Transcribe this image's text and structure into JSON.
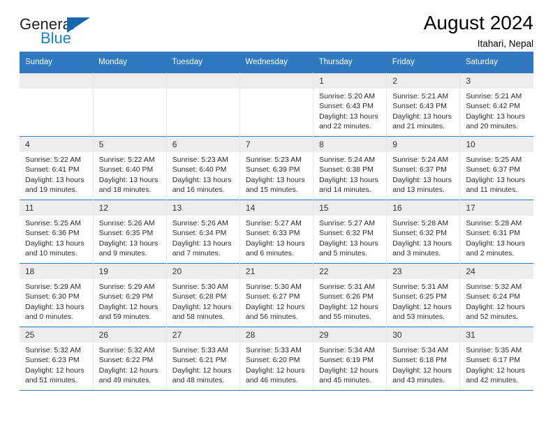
{
  "brand": {
    "name_part1": "General",
    "name_part2": "Blue",
    "accent_color": "#1767ad",
    "text_color": "#231f20"
  },
  "header": {
    "title": "August 2024",
    "location": "Itahari, Nepal"
  },
  "calendar": {
    "header_bg": "#2e79c0",
    "daynum_bg": "#ededed",
    "weekday_headers": [
      "Sunday",
      "Monday",
      "Tuesday",
      "Wednesday",
      "Thursday",
      "Friday",
      "Saturday"
    ],
    "labels": {
      "sunrise_prefix": "Sunrise:",
      "sunset_prefix": "Sunset:",
      "daylight_prefix": "Daylight:"
    },
    "weeks": [
      [
        {
          "day": "",
          "sunrise": "",
          "sunset": "",
          "daylight_line1": "",
          "daylight_line2": ""
        },
        {
          "day": "",
          "sunrise": "",
          "sunset": "",
          "daylight_line1": "",
          "daylight_line2": ""
        },
        {
          "day": "",
          "sunrise": "",
          "sunset": "",
          "daylight_line1": "",
          "daylight_line2": ""
        },
        {
          "day": "",
          "sunrise": "",
          "sunset": "",
          "daylight_line1": "",
          "daylight_line2": ""
        },
        {
          "day": "1",
          "sunrise": "Sunrise: 5:20 AM",
          "sunset": "Sunset: 6:43 PM",
          "daylight_line1": "Daylight: 13 hours",
          "daylight_line2": "and 22 minutes."
        },
        {
          "day": "2",
          "sunrise": "Sunrise: 5:21 AM",
          "sunset": "Sunset: 6:43 PM",
          "daylight_line1": "Daylight: 13 hours",
          "daylight_line2": "and 21 minutes."
        },
        {
          "day": "3",
          "sunrise": "Sunrise: 5:21 AM",
          "sunset": "Sunset: 6:42 PM",
          "daylight_line1": "Daylight: 13 hours",
          "daylight_line2": "and 20 minutes."
        }
      ],
      [
        {
          "day": "4",
          "sunrise": "Sunrise: 5:22 AM",
          "sunset": "Sunset: 6:41 PM",
          "daylight_line1": "Daylight: 13 hours",
          "daylight_line2": "and 19 minutes."
        },
        {
          "day": "5",
          "sunrise": "Sunrise: 5:22 AM",
          "sunset": "Sunset: 6:40 PM",
          "daylight_line1": "Daylight: 13 hours",
          "daylight_line2": "and 18 minutes."
        },
        {
          "day": "6",
          "sunrise": "Sunrise: 5:23 AM",
          "sunset": "Sunset: 6:40 PM",
          "daylight_line1": "Daylight: 13 hours",
          "daylight_line2": "and 16 minutes."
        },
        {
          "day": "7",
          "sunrise": "Sunrise: 5:23 AM",
          "sunset": "Sunset: 6:39 PM",
          "daylight_line1": "Daylight: 13 hours",
          "daylight_line2": "and 15 minutes."
        },
        {
          "day": "8",
          "sunrise": "Sunrise: 5:24 AM",
          "sunset": "Sunset: 6:38 PM",
          "daylight_line1": "Daylight: 13 hours",
          "daylight_line2": "and 14 minutes."
        },
        {
          "day": "9",
          "sunrise": "Sunrise: 5:24 AM",
          "sunset": "Sunset: 6:37 PM",
          "daylight_line1": "Daylight: 13 hours",
          "daylight_line2": "and 13 minutes."
        },
        {
          "day": "10",
          "sunrise": "Sunrise: 5:25 AM",
          "sunset": "Sunset: 6:37 PM",
          "daylight_line1": "Daylight: 13 hours",
          "daylight_line2": "and 11 minutes."
        }
      ],
      [
        {
          "day": "11",
          "sunrise": "Sunrise: 5:25 AM",
          "sunset": "Sunset: 6:36 PM",
          "daylight_line1": "Daylight: 13 hours",
          "daylight_line2": "and 10 minutes."
        },
        {
          "day": "12",
          "sunrise": "Sunrise: 5:26 AM",
          "sunset": "Sunset: 6:35 PM",
          "daylight_line1": "Daylight: 13 hours",
          "daylight_line2": "and 9 minutes."
        },
        {
          "day": "13",
          "sunrise": "Sunrise: 5:26 AM",
          "sunset": "Sunset: 6:34 PM",
          "daylight_line1": "Daylight: 13 hours",
          "daylight_line2": "and 7 minutes."
        },
        {
          "day": "14",
          "sunrise": "Sunrise: 5:27 AM",
          "sunset": "Sunset: 6:33 PM",
          "daylight_line1": "Daylight: 13 hours",
          "daylight_line2": "and 6 minutes."
        },
        {
          "day": "15",
          "sunrise": "Sunrise: 5:27 AM",
          "sunset": "Sunset: 6:32 PM",
          "daylight_line1": "Daylight: 13 hours",
          "daylight_line2": "and 5 minutes."
        },
        {
          "day": "16",
          "sunrise": "Sunrise: 5:28 AM",
          "sunset": "Sunset: 6:32 PM",
          "daylight_line1": "Daylight: 13 hours",
          "daylight_line2": "and 3 minutes."
        },
        {
          "day": "17",
          "sunrise": "Sunrise: 5:28 AM",
          "sunset": "Sunset: 6:31 PM",
          "daylight_line1": "Daylight: 13 hours",
          "daylight_line2": "and 2 minutes."
        }
      ],
      [
        {
          "day": "18",
          "sunrise": "Sunrise: 5:29 AM",
          "sunset": "Sunset: 6:30 PM",
          "daylight_line1": "Daylight: 13 hours",
          "daylight_line2": "and 0 minutes."
        },
        {
          "day": "19",
          "sunrise": "Sunrise: 5:29 AM",
          "sunset": "Sunset: 6:29 PM",
          "daylight_line1": "Daylight: 12 hours",
          "daylight_line2": "and 59 minutes."
        },
        {
          "day": "20",
          "sunrise": "Sunrise: 5:30 AM",
          "sunset": "Sunset: 6:28 PM",
          "daylight_line1": "Daylight: 12 hours",
          "daylight_line2": "and 58 minutes."
        },
        {
          "day": "21",
          "sunrise": "Sunrise: 5:30 AM",
          "sunset": "Sunset: 6:27 PM",
          "daylight_line1": "Daylight: 12 hours",
          "daylight_line2": "and 56 minutes."
        },
        {
          "day": "22",
          "sunrise": "Sunrise: 5:31 AM",
          "sunset": "Sunset: 6:26 PM",
          "daylight_line1": "Daylight: 12 hours",
          "daylight_line2": "and 55 minutes."
        },
        {
          "day": "23",
          "sunrise": "Sunrise: 5:31 AM",
          "sunset": "Sunset: 6:25 PM",
          "daylight_line1": "Daylight: 12 hours",
          "daylight_line2": "and 53 minutes."
        },
        {
          "day": "24",
          "sunrise": "Sunrise: 5:32 AM",
          "sunset": "Sunset: 6:24 PM",
          "daylight_line1": "Daylight: 12 hours",
          "daylight_line2": "and 52 minutes."
        }
      ],
      [
        {
          "day": "25",
          "sunrise": "Sunrise: 5:32 AM",
          "sunset": "Sunset: 6:23 PM",
          "daylight_line1": "Daylight: 12 hours",
          "daylight_line2": "and 51 minutes."
        },
        {
          "day": "26",
          "sunrise": "Sunrise: 5:32 AM",
          "sunset": "Sunset: 6:22 PM",
          "daylight_line1": "Daylight: 12 hours",
          "daylight_line2": "and 49 minutes."
        },
        {
          "day": "27",
          "sunrise": "Sunrise: 5:33 AM",
          "sunset": "Sunset: 6:21 PM",
          "daylight_line1": "Daylight: 12 hours",
          "daylight_line2": "and 48 minutes."
        },
        {
          "day": "28",
          "sunrise": "Sunrise: 5:33 AM",
          "sunset": "Sunset: 6:20 PM",
          "daylight_line1": "Daylight: 12 hours",
          "daylight_line2": "and 46 minutes."
        },
        {
          "day": "29",
          "sunrise": "Sunrise: 5:34 AM",
          "sunset": "Sunset: 6:19 PM",
          "daylight_line1": "Daylight: 12 hours",
          "daylight_line2": "and 45 minutes."
        },
        {
          "day": "30",
          "sunrise": "Sunrise: 5:34 AM",
          "sunset": "Sunset: 6:18 PM",
          "daylight_line1": "Daylight: 12 hours",
          "daylight_line2": "and 43 minutes."
        },
        {
          "day": "31",
          "sunrise": "Sunrise: 5:35 AM",
          "sunset": "Sunset: 6:17 PM",
          "daylight_line1": "Daylight: 12 hours",
          "daylight_line2": "and 42 minutes."
        }
      ]
    ]
  }
}
